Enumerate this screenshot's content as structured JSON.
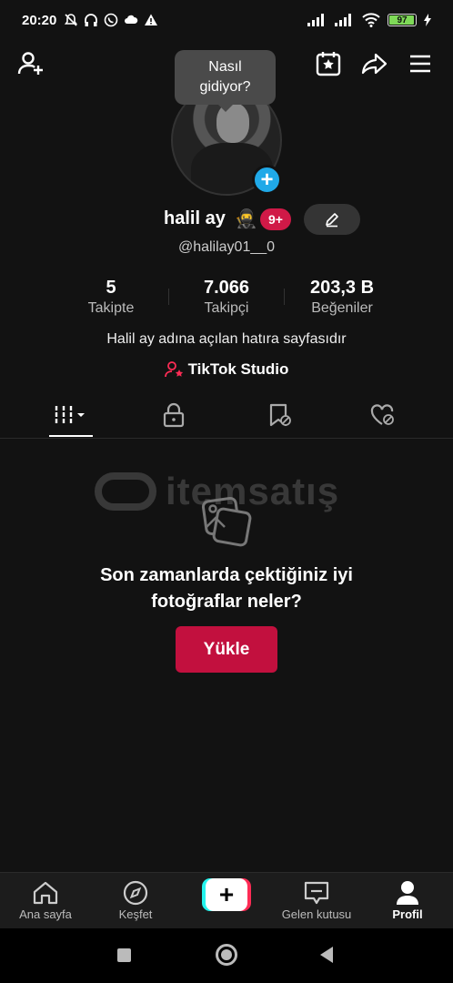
{
  "status": {
    "time": "20:20",
    "battery": "97"
  },
  "tooltip": {
    "line1": "Nasıl",
    "line2": "gidiyor?"
  },
  "profile": {
    "name": "halil ay",
    "emoji": "🥷",
    "badge": "9+",
    "username": "@halilay01__0",
    "bio": "Halil ay adına açılan hatıra sayfasıdır",
    "studio_label": "TikTok Studio"
  },
  "stats": [
    {
      "value": "5",
      "label": "Takipte"
    },
    {
      "value": "7.066",
      "label": "Takipçi"
    },
    {
      "value": "203,3 B",
      "label": "Beğeniler"
    }
  ],
  "empty_state": {
    "title_line1": "Son zamanlarda çektiğiniz iyi",
    "title_line2": "fotoğraflar neler?",
    "button": "Yükle"
  },
  "watermark": "itemsatış",
  "nav": {
    "home": "Ana sayfa",
    "discover": "Keşfet",
    "inbox": "Gelen kutusu",
    "profile": "Profil"
  },
  "colors": {
    "accent": "#c2103e",
    "badge": "#d01947",
    "add_badge": "#20a9e8"
  }
}
